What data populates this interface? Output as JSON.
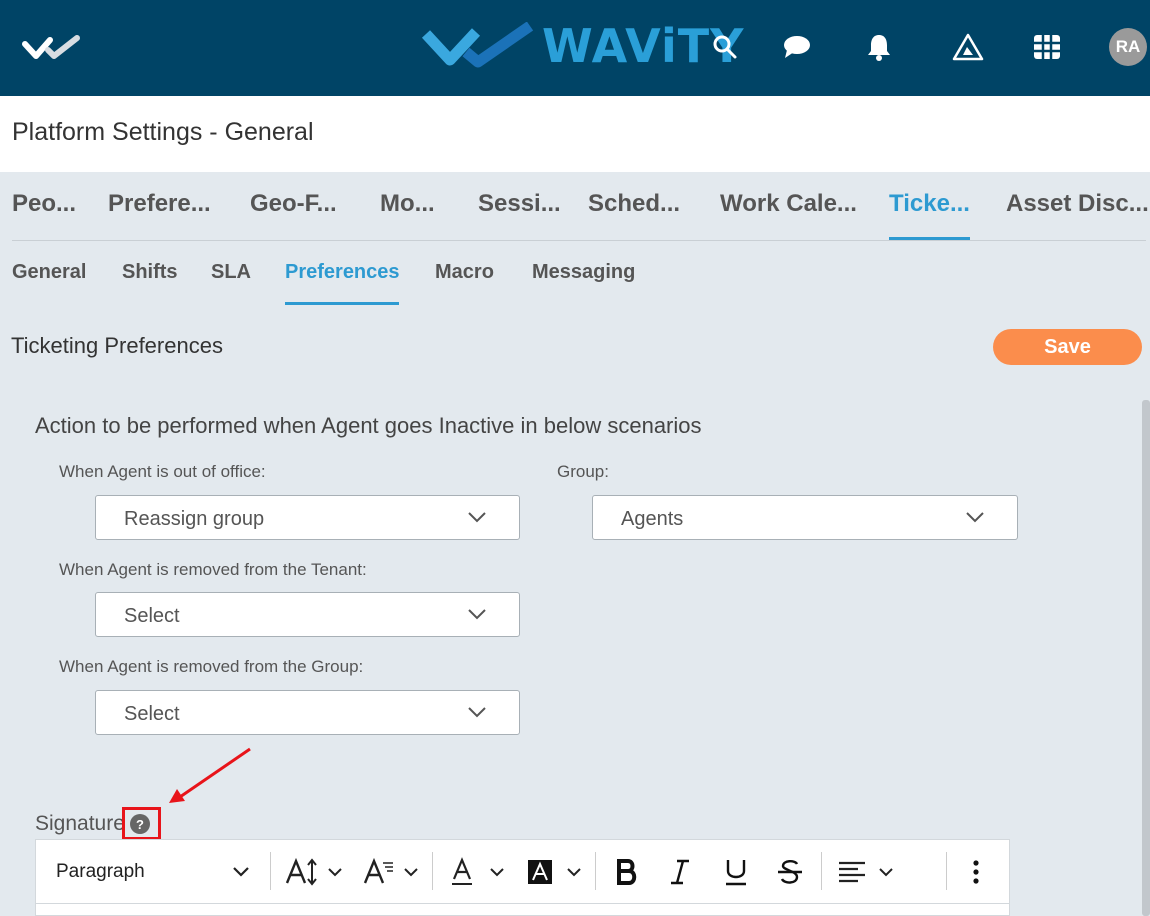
{
  "header": {
    "brand_text": "WAViTY",
    "brand_color": "#2a9fd8",
    "bar_color": "#004466",
    "icons": [
      "logo-check-icon",
      "search-icon",
      "chat-icon",
      "bell-icon",
      "alert-triangle-icon",
      "grid-icon"
    ],
    "avatar_initials": "RA"
  },
  "page": {
    "title": "Platform Settings - General"
  },
  "main_tabs": [
    {
      "label": "Peo..."
    },
    {
      "label": "Prefere..."
    },
    {
      "label": "Geo-F..."
    },
    {
      "label": "Mo..."
    },
    {
      "label": "Sessi..."
    },
    {
      "label": "Sched..."
    },
    {
      "label": "Work Cale..."
    },
    {
      "label": "Ticke...",
      "active": true
    },
    {
      "label": "Asset Disc..."
    }
  ],
  "sub_tabs": [
    {
      "label": "General"
    },
    {
      "label": "Shifts"
    },
    {
      "label": "SLA"
    },
    {
      "label": "Preferences",
      "active": true
    },
    {
      "label": "Macro"
    },
    {
      "label": "Messaging"
    }
  ],
  "accent_color": "#2d9ad1",
  "section": {
    "title": "Ticketing Preferences",
    "save_label": "Save",
    "save_color": "#fb8d4c"
  },
  "form": {
    "heading": "Action to be performed when Agent goes Inactive in below scenarios",
    "out_of_office_label": "When Agent is out of office:",
    "out_of_office_value": "Reassign group",
    "group_label": "Group:",
    "group_value": "Agents",
    "removed_tenant_label": "When Agent is removed from the Tenant:",
    "removed_tenant_value": "Select",
    "removed_group_label": "When Agent is removed from the Group:",
    "removed_group_value": "Select"
  },
  "signature": {
    "label": "Signature",
    "help_glyph": "?",
    "paragraph_label": "Paragraph",
    "toolbar_icons": [
      "font-size-icon",
      "line-height-icon",
      "font-color-icon",
      "background-color-icon",
      "bold-icon",
      "italic-icon",
      "underline-icon",
      "strikethrough-icon",
      "align-icon",
      "more-vertical-icon"
    ],
    "highlight_color": "#e8141a"
  }
}
